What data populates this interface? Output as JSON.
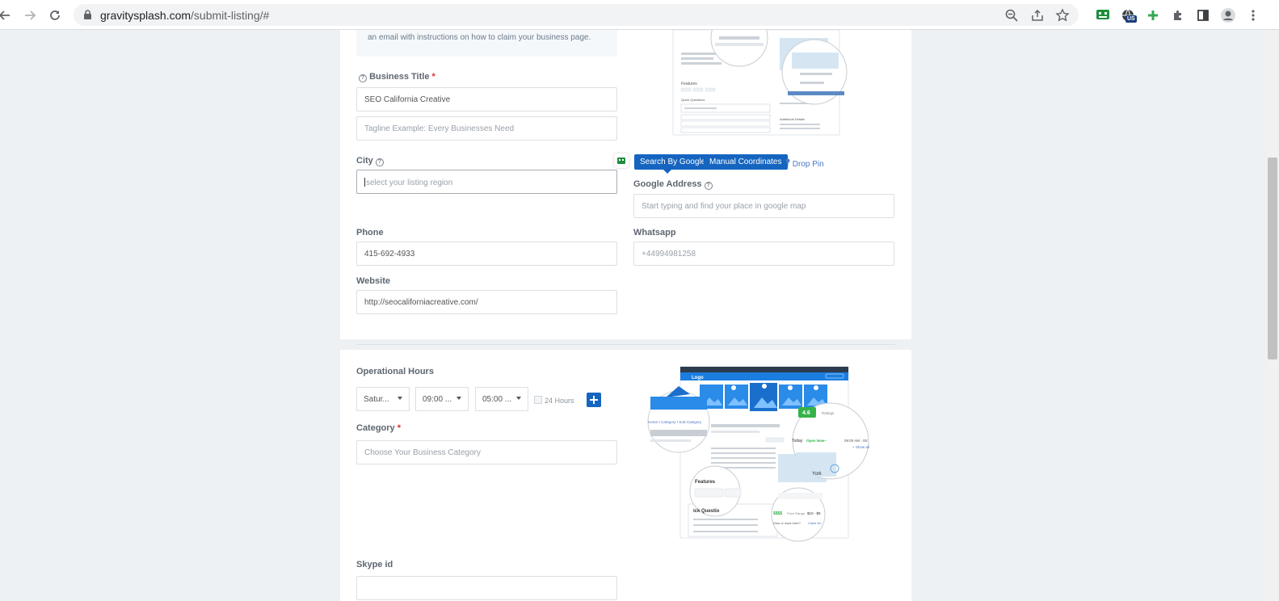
{
  "browser": {
    "url_domain": "gravitysplash.com",
    "url_path": "/submit-listing/#",
    "ext_badge": "US"
  },
  "info": {
    "text": "an email with instructions on how to claim your business page."
  },
  "business_title": {
    "label": "Business Title",
    "required_mark": "*",
    "value": "SEO California Creative",
    "tagline_placeholder": "Tagline Example: Every Businesses Need"
  },
  "city": {
    "label": "City",
    "placeholder": "select your listing region"
  },
  "location_buttons": {
    "search_by_google": "Search By Google",
    "manual_coordinates": "Manual Coordinates",
    "drop_pin": "Drop Pin"
  },
  "google_address": {
    "label": "Google Address",
    "placeholder": "Start typing and find your place in google map"
  },
  "phone": {
    "label": "Phone",
    "value": "415-692-4933"
  },
  "whatsapp": {
    "label": "Whatsapp",
    "placeholder": "+44994981258"
  },
  "website": {
    "label": "Website",
    "value": "http://seocaliforniacreative.com/"
  },
  "operational_hours": {
    "label": "Operational Hours",
    "day": "Satur...",
    "open": "09:00 ...",
    "close": "05:00 ...",
    "hours24_label": "24 Hours"
  },
  "category": {
    "label": "Category",
    "required_mark": "*",
    "placeholder": "Choose Your Business Category"
  },
  "skype": {
    "label": "Skype id",
    "value": ""
  },
  "illustration": {
    "logo_text": "Logo",
    "breadcrumb": "Home • Category • Sub-Category",
    "rating": "4.6",
    "ratings_text": "Ratings",
    "today": "Today",
    "open_now": "Open Now~",
    "hours": "09:00 AM - 05:",
    "show_all": "+ Show all",
    "city_fragment": "York",
    "features": "Features",
    "quick_questions": "ick Questio",
    "price_tag": "$$$$",
    "price_range": "Price Range",
    "price_value": "$10 - $9",
    "claim_question": "Own or work here?",
    "claim_link": "Claim No",
    "top_features": "Features",
    "top_quick_questions": "Quick Questions",
    "top_additional": "Additional Details"
  }
}
